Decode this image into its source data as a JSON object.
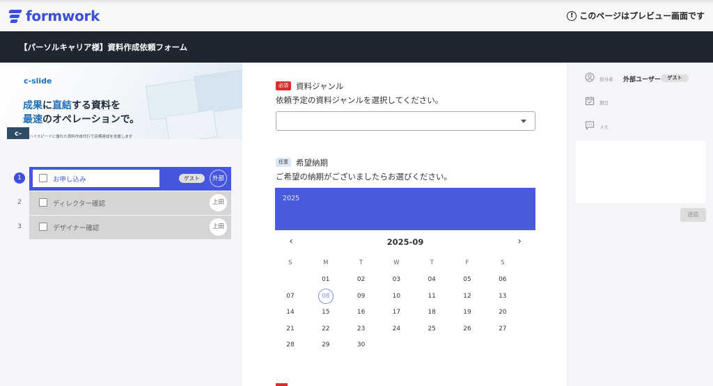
{
  "app": {
    "name": "formwork",
    "preview_note": "このページはプレビュー画面です"
  },
  "form": {
    "title": "【パーソルキャリア様】資料作成依頼フォーム"
  },
  "banner": {
    "brand": "c-slide",
    "headline_1a": "成果",
    "headline_1b": "に",
    "headline_1c": "直結",
    "headline_1d": "する資料を",
    "headline_2a": "最速",
    "headline_2b": "のオペレーションで。",
    "subline": "ハイスピードに優れた資料作成代行で目標達成を支援します",
    "badge": "c-\nslide"
  },
  "steps": [
    {
      "num": "1",
      "label": "お申し込み",
      "tag": "ゲスト",
      "avatar": "外部",
      "active": true
    },
    {
      "num": "2",
      "label": "ディレクター確認",
      "tag": "",
      "avatar": "上田",
      "active": false
    },
    {
      "num": "3",
      "label": "デザイナー確認",
      "tag": "",
      "avatar": "上田",
      "active": false
    }
  ],
  "fields": {
    "genre": {
      "badge": "必須",
      "label": "資料ジャンル",
      "description": "依頼予定の資料ジャンルを選択してください。",
      "value": ""
    },
    "deadline": {
      "badge": "任意",
      "label": "希望納期",
      "description": "ご希望の納期がございましたらお選びください。"
    }
  },
  "calendar": {
    "year": "2025",
    "month_label": "2025-09",
    "prev": "‹",
    "next": "›",
    "weekdays": [
      "S",
      "M",
      "T",
      "W",
      "T",
      "F",
      "S"
    ],
    "today": "08",
    "weeks": [
      [
        "",
        "01",
        "02",
        "03",
        "04",
        "05",
        "06"
      ],
      [
        "07",
        "08",
        "09",
        "10",
        "11",
        "12",
        "13"
      ],
      [
        "14",
        "15",
        "16",
        "17",
        "18",
        "19",
        "20"
      ],
      [
        "21",
        "22",
        "23",
        "24",
        "25",
        "26",
        "27"
      ],
      [
        "28",
        "29",
        "30",
        "",
        "",
        "",
        ""
      ]
    ]
  },
  "sidebar": {
    "assignee_label": "担当者",
    "assignee_value": "外部ユーザー",
    "assignee_tag": "ゲスト",
    "date_label": "期日",
    "memo_label": "メモ",
    "send_label": "送信"
  },
  "colors": {
    "brand": "#3b4fd8",
    "accent": "#4a5bdb",
    "required": "#d92d2d",
    "titlebar": "#1f2631"
  }
}
